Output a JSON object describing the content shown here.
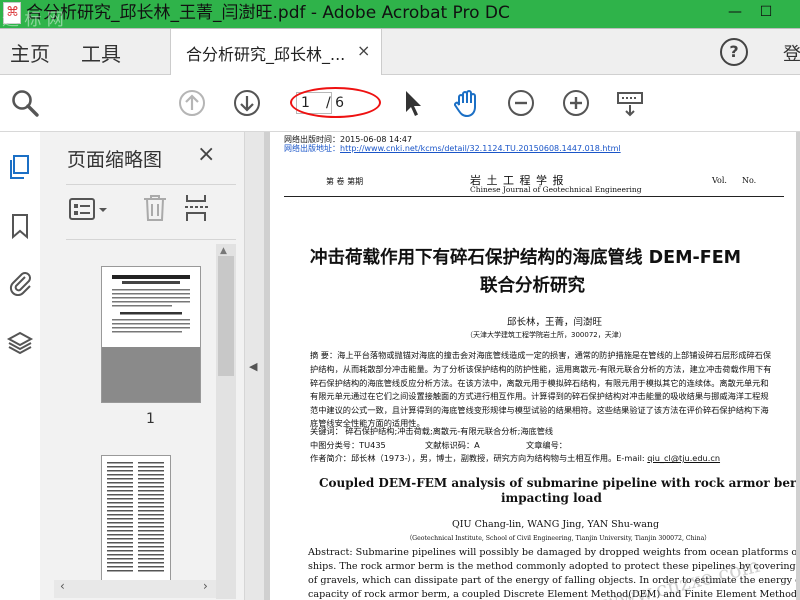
{
  "window": {
    "title": "合分析研究_邱长林_王菁_闫澍旺.pdf - Adobe Acrobat Pro DC",
    "controls": {
      "minimize": "—",
      "maximize": "☐"
    }
  },
  "tabs": {
    "home": "主页",
    "tools": "工具",
    "document": "合分析研究_邱长林_...",
    "document_close": "×",
    "help": "?",
    "sign_in": "登"
  },
  "toolbar": {
    "page_current": "1",
    "page_total": "/ 6"
  },
  "thumbnails": {
    "title": "页面缩略图",
    "close": "×",
    "page_label": "1"
  },
  "document": {
    "publish_time": "网络出版时间：2015-06-08 14:47",
    "publish_url_label": "网络出版地址：",
    "publish_url": "http://www.cnki.net/kcms/detail/32.1124.TU.20150608.1447.018.html",
    "header_left": "第   卷   第期",
    "journal_zh": "岩  土  工  程  学  报",
    "journal_en": "Chinese Journal of Geotechnical Engineering",
    "header_vol": "Vol.",
    "header_no": "No.",
    "title_zh_line1": "冲击荷载作用下有碎石保护结构的海底管线 DEM-FEM",
    "title_zh_line2": "联合分析研究",
    "authors_zh": "邱长林，王菁，闫澍旺",
    "affiliation_zh": "（天津大学建筑工程学院岩土所，300072，天津）",
    "abstract_zh": [
      "摘  要：海上平台落物或抛锚对海底的撞击会对海底管线造成一定的损害，通常的防护措施是在管线的上部铺设碎石层形成碎石保",
      "护结构，从而耗散部分冲击能量。为了分析该保护结构的防护性能，运用离散元-有限元联合分析的方法，建立冲击荷载作用下有",
      "碎石保护结构的海底管线反应分析方法。在该方法中，离散元用于模拟碎石结构，有限元用于模拟其它的连续体。离散元单元和",
      "有限元单元通过在它们之间设置接触面的方式进行相互作用。计算得到的碎石保护结构对冲击能量的吸收结果与挪威海洋工程规",
      "范中建议的公式一致，且计算得到的海底管线变形规律与模型试验的结果相符。这些结果验证了该方法在评价碎石保护结构下海",
      "底管线安全性能方面的适用性。"
    ],
    "keywords_zh": "关键词：    碎石保护结构;冲击荷载;离散元-有限元联合分析;海底管线",
    "class_no": "中图分类号：TU435",
    "doc_code": "文献标识码：A",
    "article_no": "文章编号：",
    "author_intro": "作者简介：邱长林（1973-），男，博士，副教授，研究方向为结构物与土相互作用。E-mail: ",
    "author_email": "qiu_cl@tju.edu.cn",
    "title_en_line1": "Coupled DEM-FEM analysis of submarine pipeline with rock armor berm under",
    "title_en_line2": "impacting load",
    "authors_en": "QIU Chang-lin, WANG Jing, YAN Shu-wang",
    "affiliation_en": "（Geotechnical Institute, School of Civil Engineering, Tianjin University, Tianjin 300072, China）",
    "abstract_en": [
      "Abstract:  Submarine pipelines will possibly be damaged by dropped weights from ocean platforms or anchors from",
      "ships. The rock armor berm is the method commonly adopted to protect these pipelines by covering them with a layer",
      "of gravels, which can dissipate part of the energy of falling objects.     In order to estimate the energy dissipating",
      "capacity of rock armor berm, a coupled Discrete Element Method(DEM) and Finite Element Method(FEM) approach is"
    ]
  },
  "watermark": {
    "top_left": "道  标  网",
    "bottom_right": "www.cnzxo.com"
  },
  "colors": {
    "titlebar": "#2fb34a",
    "link": "#1a55c8",
    "annotation_oval": "#e11111",
    "icon_blue": "#1b6fc5"
  }
}
